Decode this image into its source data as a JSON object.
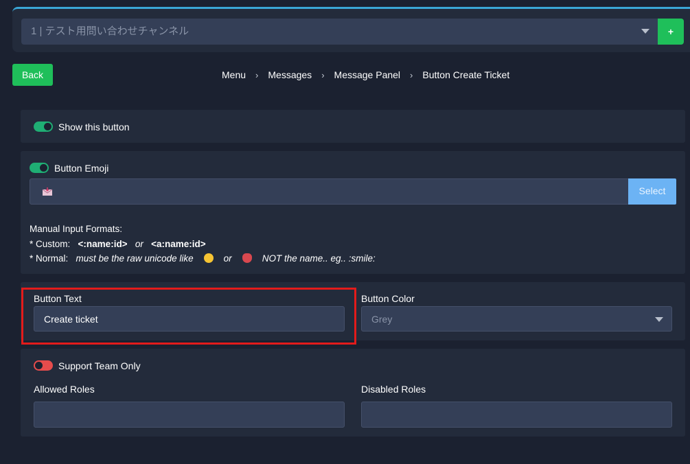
{
  "channel": {
    "value": "1 | テスト用問い合わせチャンネル",
    "add_label": "+"
  },
  "nav": {
    "back_label": "Back",
    "breadcrumb": [
      "Menu",
      "Messages",
      "Message Panel",
      "Button Create Ticket"
    ]
  },
  "show_button": {
    "label": "Show this button",
    "enabled": true
  },
  "emoji": {
    "label": "Button Emoji",
    "enabled": true,
    "select_label": "Select",
    "formats_title": "Manual Input Formats:",
    "custom_label": "* Custom:",
    "custom_format_1": "<:name:id>",
    "or_1": "or",
    "custom_format_2": "<a:name:id>",
    "normal_label": "* Normal:",
    "normal_text": "must be the raw unicode like",
    "or_2": "or",
    "normal_note": "NOT the name.. eg.. :smile:"
  },
  "button_text": {
    "label": "Button Text",
    "value": "Create ticket"
  },
  "button_color": {
    "label": "Button Color",
    "value": "Grey"
  },
  "support_team": {
    "label": "Support Team Only",
    "enabled": false
  },
  "roles": {
    "allowed_label": "Allowed Roles",
    "disabled_label": "Disabled Roles"
  },
  "colors": {
    "accent_green": "#1fbf5a",
    "toggle_on": "#1fae74",
    "toggle_off": "#e64c4c",
    "highlight": "#e31b1b",
    "select_blue": "#6cb3f4"
  }
}
